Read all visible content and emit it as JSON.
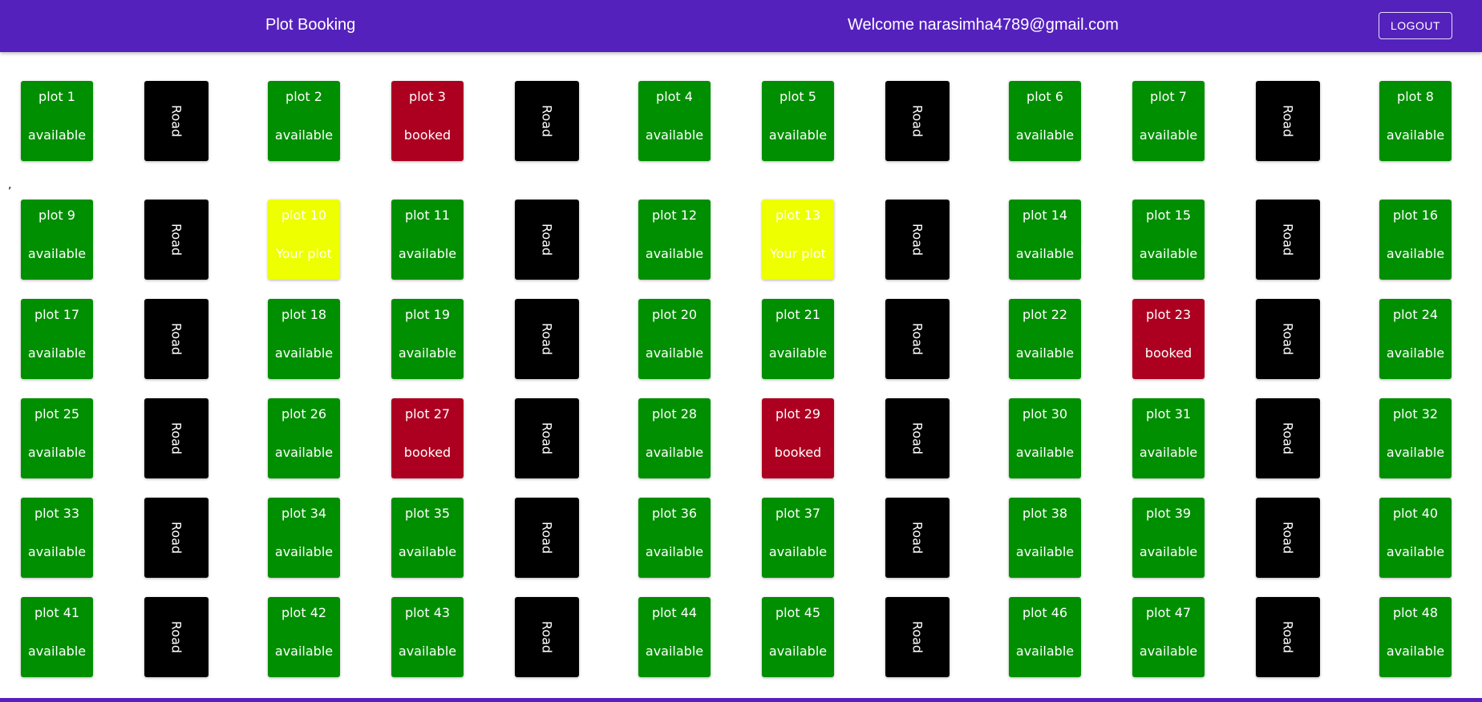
{
  "header": {
    "title": "Plot Booking",
    "welcome": "Welcome narasimha4789@gmail.com",
    "logout_label": "LOGOUT"
  },
  "stray_mark": ",",
  "road_label": "Road",
  "colors": {
    "appbar": "#5521bd",
    "available": "#008f00",
    "booked": "#ad0021",
    "your_plot": "#eeff00",
    "road": "#000000"
  },
  "plots": [
    {
      "name": "plot 1",
      "status": "available"
    },
    {
      "name": "plot 2",
      "status": "available"
    },
    {
      "name": "plot 3",
      "status": "booked"
    },
    {
      "name": "plot 4",
      "status": "available"
    },
    {
      "name": "plot 5",
      "status": "available"
    },
    {
      "name": "plot 6",
      "status": "available"
    },
    {
      "name": "plot 7",
      "status": "available"
    },
    {
      "name": "plot 8",
      "status": "available"
    },
    {
      "name": "plot 9",
      "status": "available"
    },
    {
      "name": "plot 10",
      "status": "Your plot"
    },
    {
      "name": "plot 11",
      "status": "available"
    },
    {
      "name": "plot 12",
      "status": "available"
    },
    {
      "name": "plot 13",
      "status": "Your plot"
    },
    {
      "name": "plot 14",
      "status": "available"
    },
    {
      "name": "plot 15",
      "status": "available"
    },
    {
      "name": "plot 16",
      "status": "available"
    },
    {
      "name": "plot 17",
      "status": "available"
    },
    {
      "name": "plot 18",
      "status": "available"
    },
    {
      "name": "plot 19",
      "status": "available"
    },
    {
      "name": "plot 20",
      "status": "available"
    },
    {
      "name": "plot 21",
      "status": "available"
    },
    {
      "name": "plot 22",
      "status": "available"
    },
    {
      "name": "plot 23",
      "status": "booked"
    },
    {
      "name": "plot 24",
      "status": "available"
    },
    {
      "name": "plot 25",
      "status": "available"
    },
    {
      "name": "plot 26",
      "status": "available"
    },
    {
      "name": "plot 27",
      "status": "booked"
    },
    {
      "name": "plot 28",
      "status": "available"
    },
    {
      "name": "plot 29",
      "status": "booked"
    },
    {
      "name": "plot 30",
      "status": "available"
    },
    {
      "name": "plot 31",
      "status": "available"
    },
    {
      "name": "plot 32",
      "status": "available"
    },
    {
      "name": "plot 33",
      "status": "available"
    },
    {
      "name": "plot 34",
      "status": "available"
    },
    {
      "name": "plot 35",
      "status": "available"
    },
    {
      "name": "plot 36",
      "status": "available"
    },
    {
      "name": "plot 37",
      "status": "available"
    },
    {
      "name": "plot 38",
      "status": "available"
    },
    {
      "name": "plot 39",
      "status": "available"
    },
    {
      "name": "plot 40",
      "status": "available"
    },
    {
      "name": "plot 41",
      "status": "available"
    },
    {
      "name": "plot 42",
      "status": "available"
    },
    {
      "name": "plot 43",
      "status": "available"
    },
    {
      "name": "plot 44",
      "status": "available"
    },
    {
      "name": "plot 45",
      "status": "available"
    },
    {
      "name": "plot 46",
      "status": "available"
    },
    {
      "name": "plot 47",
      "status": "available"
    },
    {
      "name": "plot 48",
      "status": "available"
    }
  ]
}
